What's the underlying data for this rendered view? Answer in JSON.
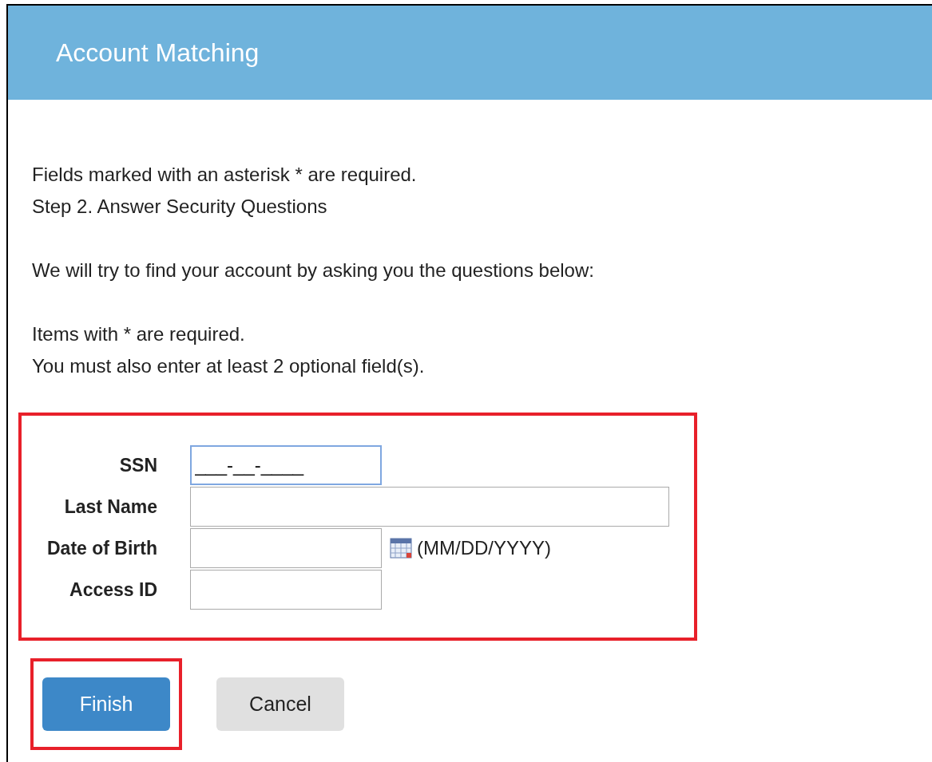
{
  "header": {
    "title": "Account Matching"
  },
  "intro": [
    [
      "Fields marked with an asterisk * are required.",
      "Step 2. Answer Security Questions"
    ],
    [
      "We will try to find your account by asking you the questions below:"
    ],
    [
      "Items with * are required.",
      "You must also enter at least 2 optional field(s)."
    ]
  ],
  "form": {
    "highlighted": true,
    "fields": [
      {
        "label": "SSN",
        "kind": "text",
        "value": "___-__-____",
        "focused": true
      },
      {
        "label": "Last Name",
        "kind": "wide",
        "focused": false
      },
      {
        "label": "Date of Birth",
        "kind": "date",
        "hint": "(MM/DD/YYYY)",
        "focused": false
      },
      {
        "label": "Access ID",
        "kind": "text",
        "focused": false
      }
    ]
  },
  "buttons": [
    {
      "label": "Finish",
      "kind": "primary",
      "highlighted": true
    },
    {
      "label": "Cancel",
      "kind": "secondary",
      "highlighted": false
    }
  ]
}
